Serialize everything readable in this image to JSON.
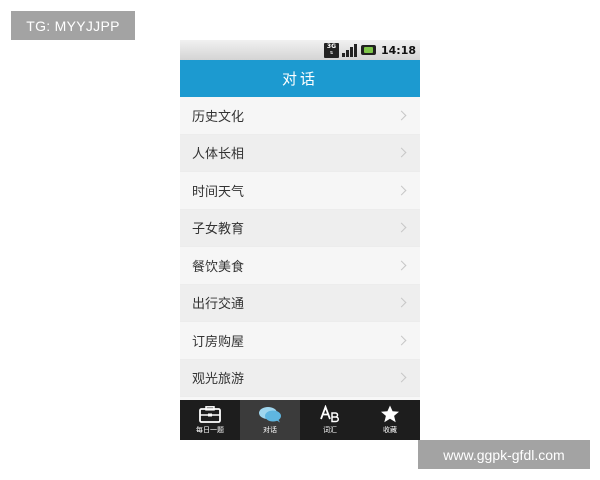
{
  "watermarks": {
    "top_left": "TG: MYYJJPP",
    "bottom_right": "www.ggpk-gfdl.com"
  },
  "statusbar": {
    "network": "3G",
    "time": "14:18"
  },
  "header": {
    "title": "对话"
  },
  "list": {
    "items": [
      {
        "label": "历史文化"
      },
      {
        "label": "人体长相"
      },
      {
        "label": "时间天气"
      },
      {
        "label": "子女教育"
      },
      {
        "label": "餐饮美食"
      },
      {
        "label": "出行交通"
      },
      {
        "label": "订房购屋"
      },
      {
        "label": "观光旅游"
      }
    ]
  },
  "tabbar": {
    "active": 1,
    "tabs": [
      {
        "label": "每日一题",
        "icon": "briefcase-icon"
      },
      {
        "label": "对话",
        "icon": "chat-bubbles-icon"
      },
      {
        "label": "词汇",
        "icon": "letters-ab-icon"
      },
      {
        "label": "收藏",
        "icon": "star-icon"
      }
    ]
  }
}
